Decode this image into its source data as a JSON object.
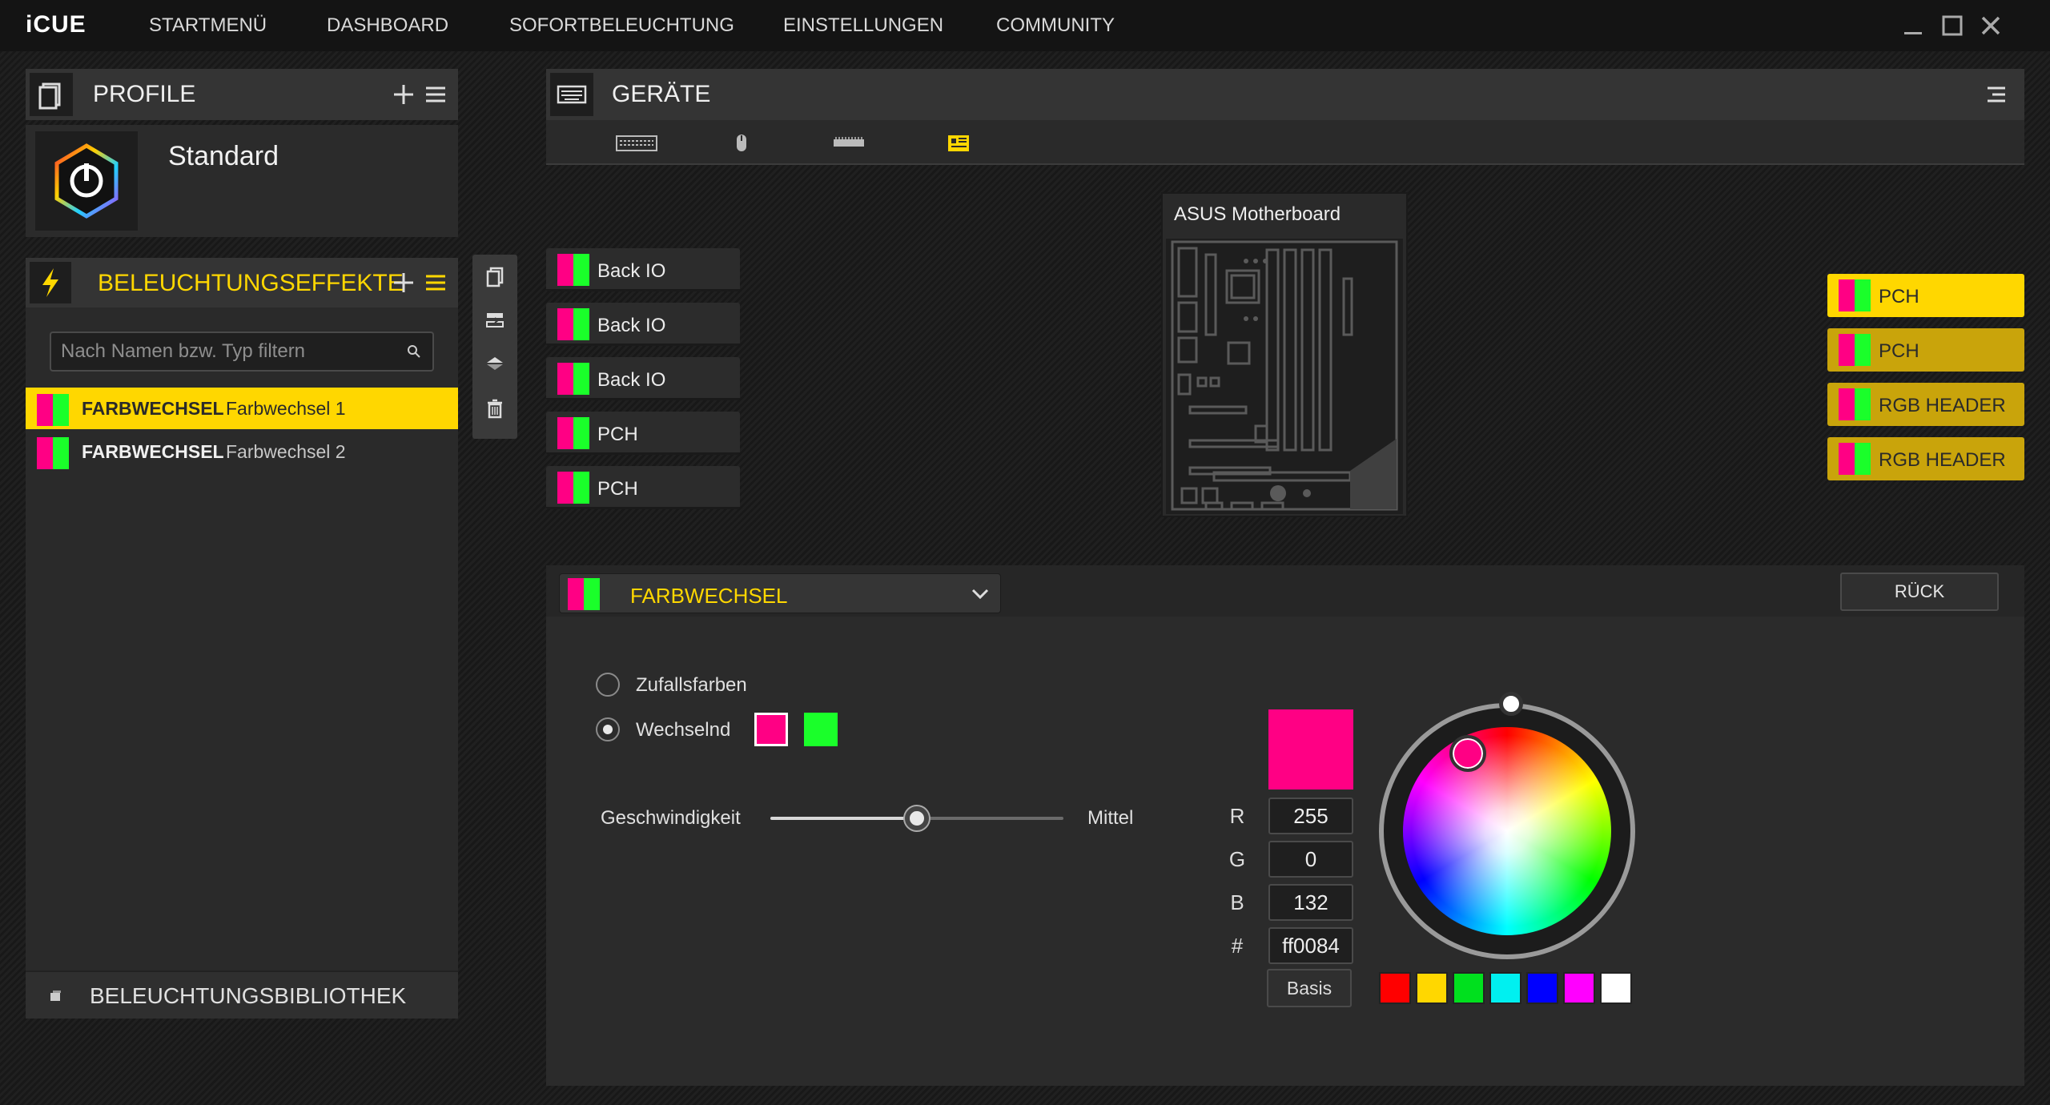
{
  "titlebar": {
    "app_name": "iCUE",
    "nav": [
      "STARTMENÜ",
      "DASHBOARD",
      "SOFORTBELEUCHTUNG",
      "EINSTELLUNGEN",
      "COMMUNITY"
    ]
  },
  "profiles": {
    "title": "PROFILE",
    "current": "Standard"
  },
  "effects": {
    "title": "BELEUCHTUNGSEFFEKTE",
    "filter_placeholder": "Nach Namen bzw. Typ filtern",
    "items": [
      {
        "type": "FARBWECHSEL",
        "name": "Farbwechsel 1",
        "selected": true
      },
      {
        "type": "FARBWECHSEL",
        "name": "Farbwechsel 2",
        "selected": false
      }
    ],
    "library_label": "BELEUCHTUNGSBIBLIOTHEK"
  },
  "devices": {
    "title": "GERÄTE",
    "tab_icons": [
      "keyboard-icon",
      "mouse-icon",
      "ram-icon",
      "motherboard-icon"
    ],
    "active_tab": 3,
    "device_name": "ASUS Motherboard",
    "left_zones": [
      "Back IO",
      "Back IO",
      "Back IO",
      "PCH",
      "PCH"
    ],
    "right_zones": [
      {
        "label": "PCH",
        "active": true
      },
      {
        "label": "PCH",
        "active": false
      },
      {
        "label": "RGB HEADER",
        "active": false
      },
      {
        "label": "RGB HEADER",
        "active": false
      }
    ]
  },
  "editor": {
    "effect_type": "FARBWECHSEL",
    "back_label": "RÜCK",
    "options": {
      "random": "Zufallsfarben",
      "alternating": "Wechselnd",
      "selected": "alternating"
    },
    "speed_label": "Geschwindigkeit",
    "speed_value_label": "Mittel",
    "speed_level": 0.5,
    "color": {
      "r": "255",
      "g": "0",
      "b": "132",
      "hex": "ff0084",
      "hex_label": "#",
      "r_label": "R",
      "g_label": "G",
      "b_label": "B"
    },
    "basis_label": "Basis",
    "presets": [
      "#ff0000",
      "#ffd700",
      "#00e01e",
      "#00f0f0",
      "#0000ff",
      "#ff00ff",
      "#ffffff"
    ]
  },
  "colors": {
    "accent": "#ffd700",
    "color1": "#ff0084",
    "color2": "#1aff2a"
  }
}
